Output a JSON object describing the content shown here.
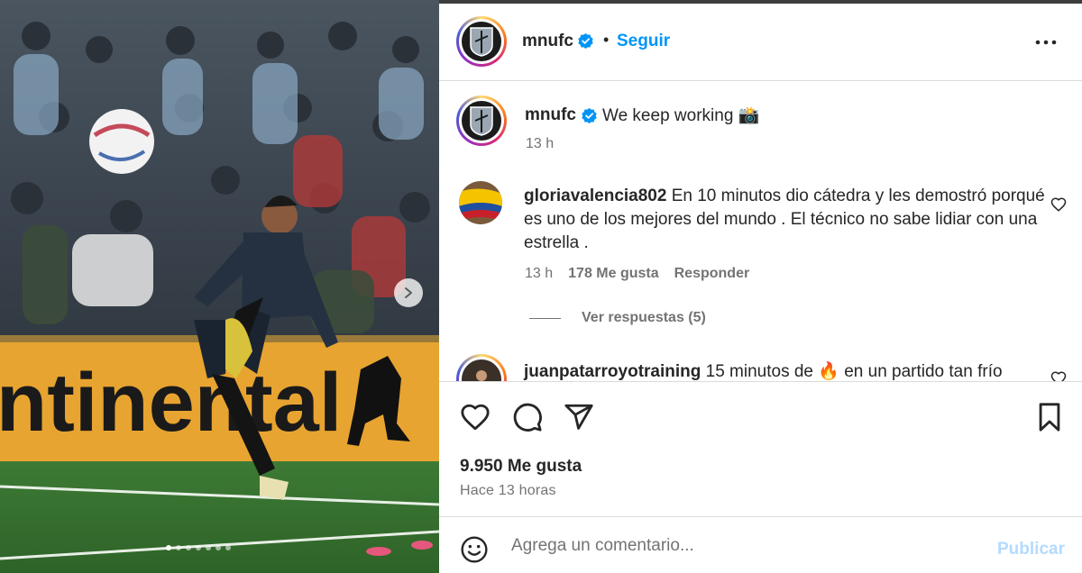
{
  "post": {
    "media": {
      "slide_count": 7,
      "active_slide": 0,
      "photo_description_icons": [
        "soccer-ball-icon",
        "player-figure",
        "crowd-figures"
      ]
    },
    "header": {
      "username": "mnufc",
      "separator": "•",
      "follow_label": "Seguir"
    },
    "caption": {
      "username": "mnufc",
      "text": "We keep working 📸",
      "time": "13 h"
    },
    "comments": [
      {
        "username": "gloriavalencia802",
        "text": "En 10 minutos dio cátedra y les demostró porqué es uno de los mejores del mundo . El técnico no sabe lidiar con una estrella .",
        "time": "13 h",
        "likes": "178 Me gusta",
        "reply_label": "Responder",
        "view_replies": "Ver respuestas (5)"
      },
      {
        "username": "juanpatarroyotraining",
        "text": "15 minutos de 🔥 en un partido tan frío"
      }
    ],
    "likes_count": "9.950 Me gusta",
    "time_ago": "Hace 13 horas",
    "composer": {
      "placeholder": "Agrega un comentario...",
      "publish_label": "Publicar"
    }
  },
  "colors": {
    "accent": "#0095f6",
    "publish_disabled": "#b3dbff",
    "muted_text": "#737373",
    "divider": "#dbdbdb"
  }
}
